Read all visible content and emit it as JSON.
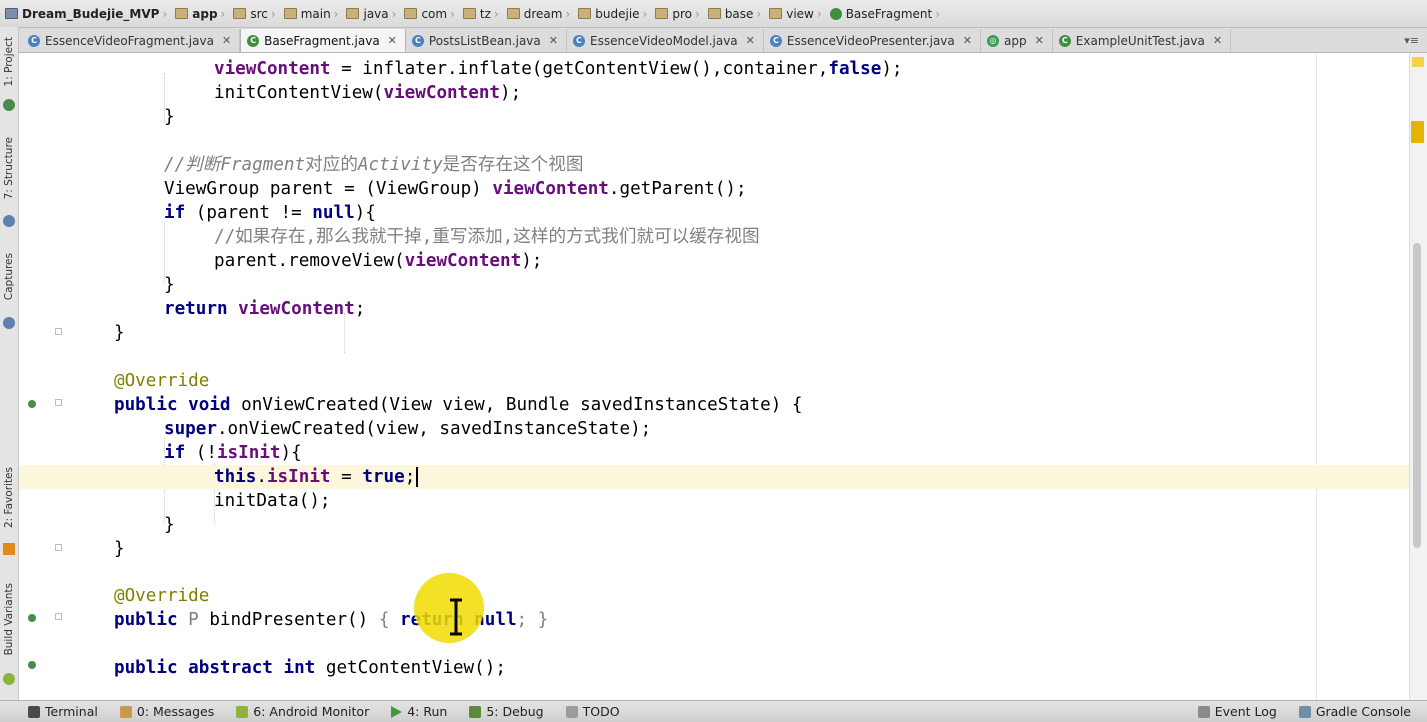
{
  "breadcrumb": [
    "Dream_Budejie_MVP",
    "app",
    "src",
    "main",
    "java",
    "com",
    "tz",
    "dream",
    "budejie",
    "pro",
    "base",
    "view",
    "BaseFragment"
  ],
  "tabs": [
    {
      "label": "EssenceVideoFragment.java",
      "active": false,
      "icon": "class-icon"
    },
    {
      "label": "BaseFragment.java",
      "active": true,
      "icon": "class-icon"
    },
    {
      "label": "PostsListBean.java",
      "active": false,
      "icon": "class-icon"
    },
    {
      "label": "EssenceVideoModel.java",
      "active": false,
      "icon": "class-icon"
    },
    {
      "label": "EssenceVideoPresenter.java",
      "active": false,
      "icon": "class-icon"
    },
    {
      "label": "app",
      "active": false,
      "icon": "module-icon"
    },
    {
      "label": "ExampleUnitTest.java",
      "active": false,
      "icon": "test-class-icon"
    }
  ],
  "tab_menu": "▾≡",
  "sidebar_tabs": [
    "1: Project",
    "7: Structure",
    "Captures",
    "2: Favorites",
    "Build Variants"
  ],
  "code": {
    "l1_field": "viewContent",
    "l1_mid": " = inflater.inflate(getContentView(),container,",
    "l1_kw": "false",
    "l1_end": ");",
    "l2_pre": "initContentView(",
    "l2_field": "viewContent",
    "l2_end": ");",
    "l3": "}",
    "l4_pre": "//判断",
    "l4_it1": "Fragment",
    "l4_mid": "对应的",
    "l4_it2": "Activity",
    "l4_end": "是否存在这个视图",
    "l5_pre": "ViewGroup parent = (ViewGroup) ",
    "l5_field": "viewContent",
    "l5_end": ".getParent();",
    "l6_kw": "if",
    "l6_mid": " (parent != ",
    "l6_kw2": "null",
    "l6_end": "){",
    "l7": "//如果存在,那么我就干掉,重写添加,这样的方式我们就可以缓存视图",
    "l8_pre": "parent.removeView(",
    "l8_field": "viewContent",
    "l8_end": ");",
    "l9": "}",
    "l10_kw": "return",
    "l10_field": "viewContent",
    "l10_end": ";",
    "l11": "}",
    "l12": "@Override",
    "l13_kw": "public void",
    "l13_end": " onViewCreated(View view, Bundle savedInstanceState) {",
    "l14_kw": "super",
    "l14_end": ".onViewCreated(view, savedInstanceState);",
    "l15_kw": "if",
    "l15_mid": " (!",
    "l15_field": "isInit",
    "l15_end": "){",
    "l16_kw": "this",
    "l16_dot": ".",
    "l16_field": "isInit",
    "l16_mid": " = ",
    "l16_kw2": "true",
    "l16_end": ";",
    "l17": "initData();",
    "l18": "}",
    "l19": "}",
    "l20": "@Override",
    "l21_kw": "public",
    "l21_typ": "P",
    "l21_mid": " bindPresenter() ",
    "l21_brace": "{ ",
    "l21_kw2": "return null",
    "l21_end": "; }",
    "l22_kw": "public abstract int",
    "l22_end": " getContentView();"
  },
  "bottom_tools": [
    {
      "label": "Terminal",
      "icon": "terminal-icon"
    },
    {
      "label": "0: Messages",
      "icon": "messages-icon"
    },
    {
      "label": "6: Android Monitor",
      "icon": "android-icon"
    },
    {
      "label": "4: Run",
      "icon": "run-icon"
    },
    {
      "label": "5: Debug",
      "icon": "debug-icon"
    },
    {
      "label": "TODO",
      "icon": "todo-icon"
    }
  ],
  "bottom_right": [
    {
      "label": "Event Log",
      "icon": "event-log-icon"
    },
    {
      "label": "Gradle Console",
      "icon": "gradle-console-icon"
    }
  ],
  "colors": {
    "keyword": "#000080",
    "field": "#660e7a",
    "comment": "#808080",
    "annotation": "#808000",
    "current_line": "#fbf6dc",
    "cursor_highlight": "#f0dc00"
  }
}
